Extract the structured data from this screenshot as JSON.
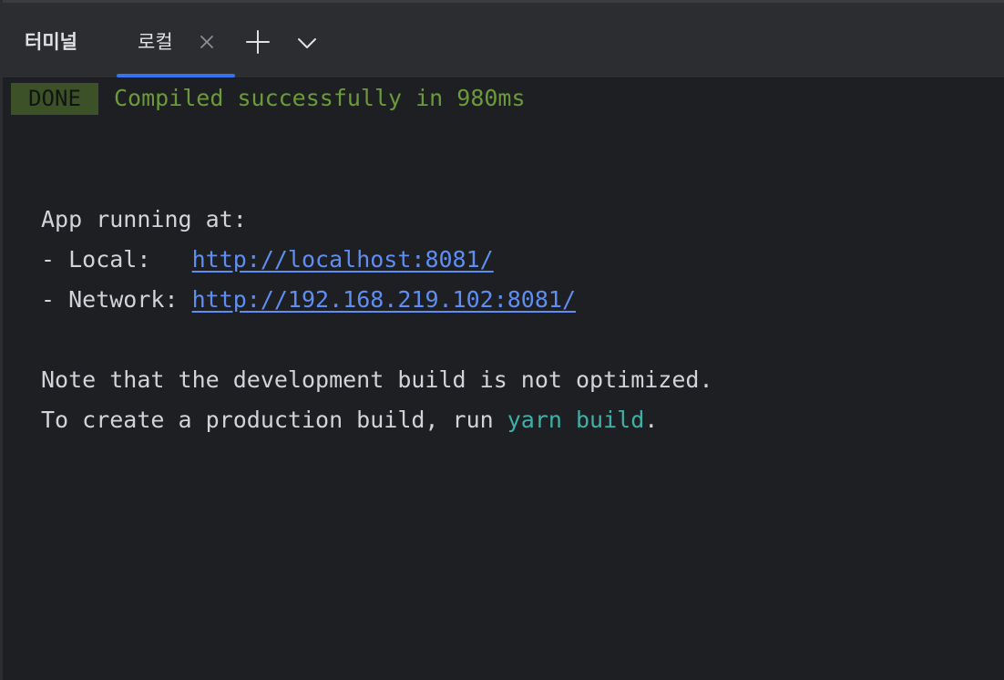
{
  "toolwindow": {
    "title": "터미널",
    "tabs": [
      {
        "label": "로컬",
        "active": true
      }
    ],
    "add_icon": "plus-icon",
    "dropdown_icon": "chevron-down-icon",
    "close_icon": "close-icon"
  },
  "terminal": {
    "done_badge": "DONE",
    "compiled_message": "Compiled successfully in 980ms",
    "app_running": "App running at:",
    "local_label": "- Local:   ",
    "local_url": "http://localhost:8081/",
    "network_label": "- Network: ",
    "network_url": "http://192.168.219.102:8081/",
    "note_line": "Note that the development build is not optimized.",
    "create_prefix": "To create a production build, run ",
    "create_cmd": "yarn build",
    "create_suffix": "."
  },
  "colors": {
    "background": "#1e1f22",
    "tabbar": "#2b2d30",
    "accent": "#3574f0",
    "done_badge_bg": "#3c5128",
    "success_text": "#6a9a3a",
    "link": "#5f8ef2",
    "command": "#3fb0a8"
  }
}
